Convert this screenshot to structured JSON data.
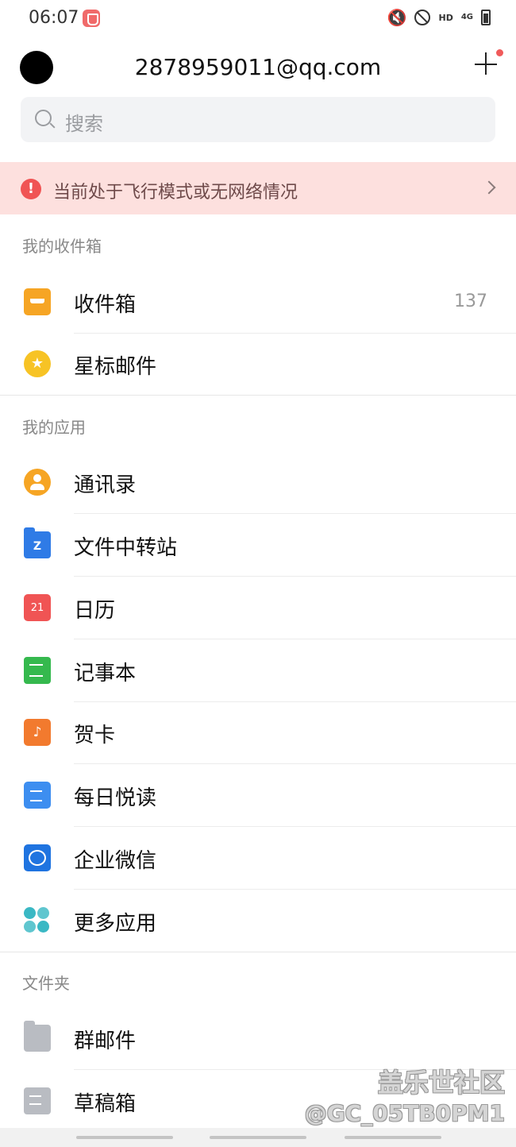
{
  "status_bar": {
    "time": "06:07",
    "hd": "HD",
    "signal": "4G"
  },
  "header": {
    "account": "2878959011@qq.com"
  },
  "search": {
    "placeholder": "搜索"
  },
  "offline_banner": {
    "text": "当前处于飞行模式或无网络情况"
  },
  "sections": {
    "mailbox_title": "我的收件箱",
    "apps_title": "我的应用",
    "folders_title": "文件夹"
  },
  "mailbox": {
    "items": [
      {
        "label": "收件箱",
        "count": "137",
        "icon": "inbox-icon"
      },
      {
        "label": "星标邮件",
        "icon": "star-icon"
      }
    ]
  },
  "apps": {
    "items": [
      {
        "label": "通讯录",
        "icon": "contacts-icon"
      },
      {
        "label": "文件中转站",
        "icon": "file-transfer-icon"
      },
      {
        "label": "日历",
        "icon": "calendar-icon",
        "icon_text": "21"
      },
      {
        "label": "记事本",
        "icon": "notepad-icon"
      },
      {
        "label": "贺卡",
        "icon": "greeting-card-icon"
      },
      {
        "label": "每日悦读",
        "icon": "daily-reading-icon"
      },
      {
        "label": "企业微信",
        "icon": "wecom-icon"
      },
      {
        "label": "更多应用",
        "icon": "more-apps-icon"
      }
    ]
  },
  "folders": {
    "items": [
      {
        "label": "群邮件",
        "icon": "group-mail-folder-icon"
      },
      {
        "label": "草稿箱",
        "icon": "drafts-icon"
      }
    ]
  },
  "watermark": {
    "line1": "盖乐世社区",
    "line2": "@GC_05TB0PM1"
  },
  "colors": {
    "banner_bg": "#fde0de",
    "alert_red": "#f05454",
    "accent_orange": "#f6a524"
  }
}
